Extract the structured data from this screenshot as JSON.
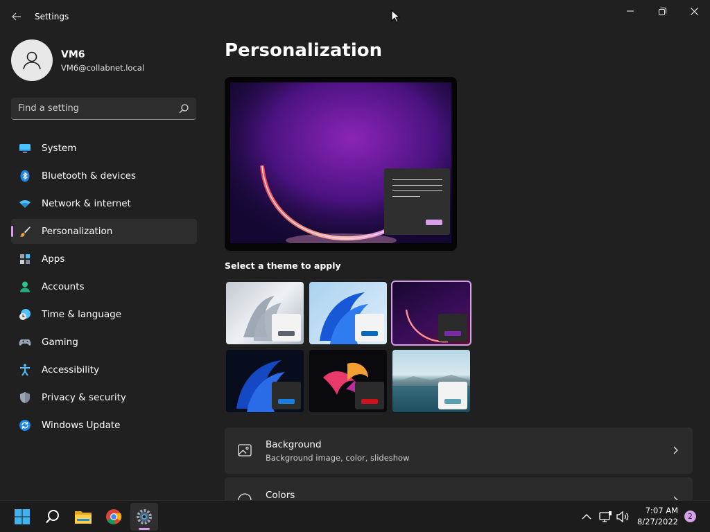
{
  "window": {
    "title": "Settings"
  },
  "profile": {
    "name": "VM6",
    "email": "VM6@collabnet.local"
  },
  "search": {
    "placeholder": "Find a setting"
  },
  "nav": {
    "items": [
      {
        "label": "System",
        "icon": "monitor-icon",
        "active": false
      },
      {
        "label": "Bluetooth & devices",
        "icon": "bluetooth-icon",
        "active": false
      },
      {
        "label": "Network & internet",
        "icon": "wifi-icon",
        "active": false
      },
      {
        "label": "Personalization",
        "icon": "brush-icon",
        "active": true
      },
      {
        "label": "Apps",
        "icon": "apps-icon",
        "active": false
      },
      {
        "label": "Accounts",
        "icon": "person-icon",
        "active": false
      },
      {
        "label": "Time & language",
        "icon": "clock-globe-icon",
        "active": false
      },
      {
        "label": "Gaming",
        "icon": "gamepad-icon",
        "active": false
      },
      {
        "label": "Accessibility",
        "icon": "accessibility-icon",
        "active": false
      },
      {
        "label": "Privacy & security",
        "icon": "shield-icon",
        "active": false
      },
      {
        "label": "Windows Update",
        "icon": "update-icon",
        "active": false
      }
    ]
  },
  "main": {
    "title": "Personalization",
    "theme_heading": "Select a theme to apply",
    "themes": [
      {
        "name": "windows-light-bloom",
        "selected": false
      },
      {
        "name": "windows-blue-light",
        "selected": false
      },
      {
        "name": "glow-dark",
        "selected": true
      },
      {
        "name": "windows-blue-dark",
        "selected": false
      },
      {
        "name": "captured-motion",
        "selected": false
      },
      {
        "name": "flow-lake",
        "selected": false
      }
    ],
    "cards": [
      {
        "title": "Background",
        "subtitle": "Background image, color, slideshow",
        "icon": "image-icon"
      },
      {
        "title": "Colors",
        "subtitle": "",
        "icon": "palette-icon"
      }
    ]
  },
  "taskbar": {
    "apps": [
      "start-icon",
      "search-icon",
      "file-explorer-icon",
      "chrome-icon",
      "settings-icon"
    ],
    "time": "7:07 AM",
    "date": "8/27/2022",
    "notifications": "2"
  },
  "colors": {
    "accent": "#d7a0ea",
    "background": "#202020",
    "card": "#2b2b2b"
  }
}
